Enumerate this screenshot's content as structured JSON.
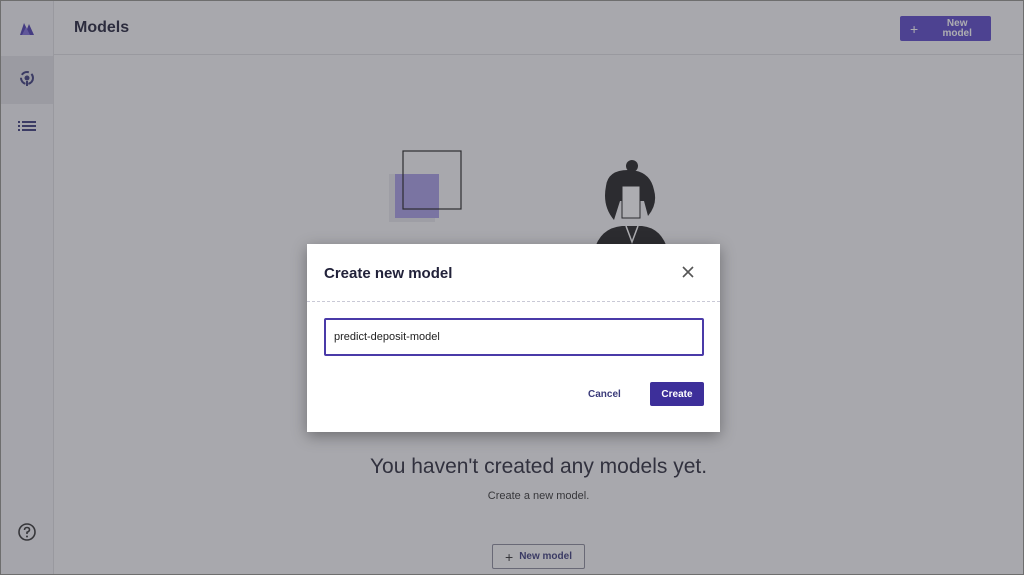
{
  "header": {
    "title": "Models",
    "new_model_label": "New model"
  },
  "sidebar": {
    "items": [
      {
        "icon": "logo-icon"
      },
      {
        "icon": "models-icon"
      },
      {
        "icon": "list-icon"
      },
      {
        "icon": "help-icon"
      }
    ]
  },
  "empty_state": {
    "title": "You haven't created any models yet.",
    "subtitle": "Create a new model.",
    "button_label": "New model"
  },
  "modal": {
    "title": "Create new model",
    "input_value": "predict-deposit-model",
    "cancel_label": "Cancel",
    "create_label": "Create"
  },
  "colors": {
    "accent": "#5a48c8",
    "accent_dark": "#3d2f9a"
  }
}
